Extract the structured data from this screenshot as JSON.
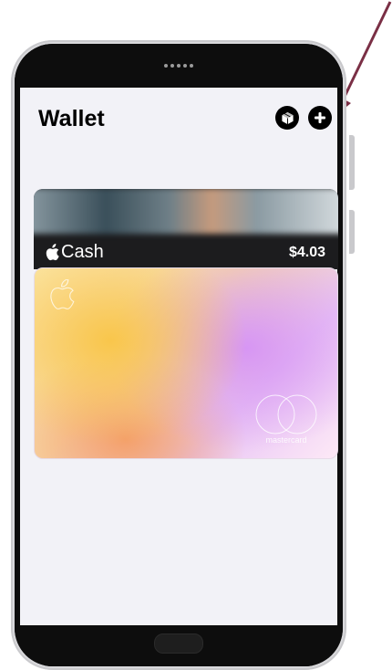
{
  "wallet": {
    "title": "Wallet",
    "icons": {
      "left": "box-icon",
      "right": "plus-icon"
    }
  },
  "cards": {
    "cash": {
      "label": "Cash",
      "amount": "$4.03"
    },
    "apple_card": {
      "network": "mastercard"
    }
  },
  "colors": {
    "background": "#f2f2f7",
    "annotation_arrow": "#7a2f45"
  }
}
